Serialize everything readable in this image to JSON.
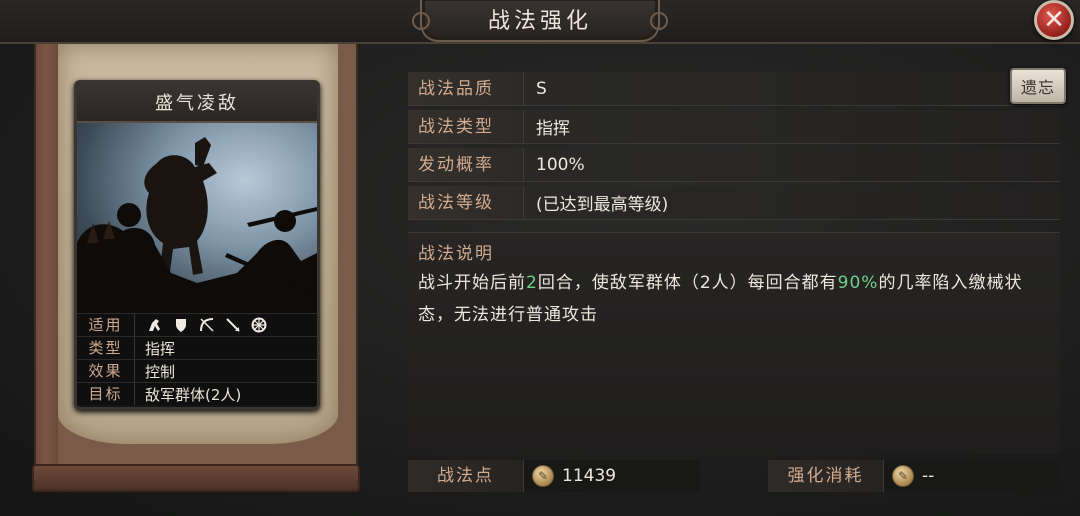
{
  "header": {
    "title": "战法强化",
    "close_symbol": "✕"
  },
  "card": {
    "name": "盛气凌敌",
    "rows": [
      {
        "key": "适用",
        "value": ""
      },
      {
        "key": "类型",
        "value": "指挥"
      },
      {
        "key": "效果",
        "value": "控制"
      },
      {
        "key": "目标",
        "value": "敌军群体(2人)"
      }
    ],
    "fit_icons": [
      "horse-icon",
      "shield-icon",
      "bow-icon",
      "spear-icon",
      "wheel-icon"
    ]
  },
  "info": {
    "rows": [
      {
        "key": "战法品质",
        "value": "S"
      },
      {
        "key": "战法类型",
        "value": "指挥"
      },
      {
        "key": "发动概率",
        "value": "100%"
      },
      {
        "key": "战法等级",
        "value": "(已达到最高等级)"
      }
    ],
    "relic_button": "遗忘"
  },
  "description": {
    "title": "战法说明",
    "part1": "战斗开始后前",
    "hl1": "2",
    "part2": "回合，使敌军群体（2人）每回合都有",
    "hl2": "90%",
    "part3": "的几率陷入缴械状态，无法进行普通攻击"
  },
  "footer": {
    "points_label": "战法点",
    "points_value": "11439",
    "cost_label": "强化消耗",
    "cost_value": "--"
  },
  "colors": {
    "highlight": "#6fcf8b",
    "label": "#d2ab8f",
    "close": "#c1302a"
  }
}
